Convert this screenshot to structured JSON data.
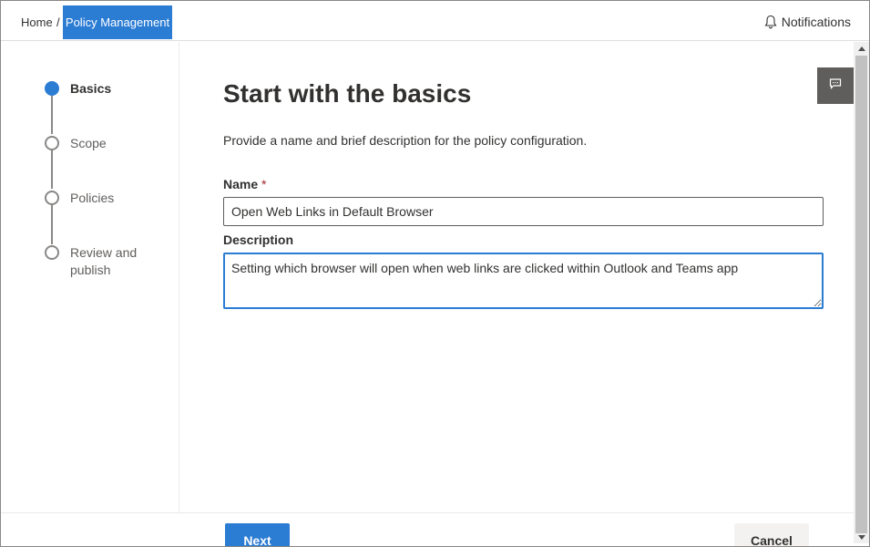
{
  "breadcrumb": {
    "home": "Home",
    "separator": "/",
    "current": "Policy Management"
  },
  "header": {
    "notifications_label": "Notifications",
    "notifications_icon": "bell-icon"
  },
  "steps": [
    {
      "label": "Basics",
      "state": "active"
    },
    {
      "label": "Scope",
      "state": "pending"
    },
    {
      "label": "Policies",
      "state": "pending"
    },
    {
      "label": "Review and publish",
      "state": "pending"
    }
  ],
  "main": {
    "title": "Start with the basics",
    "description": "Provide a name and brief description for the policy configuration.",
    "name_label": "Name",
    "required_marker": "*",
    "name_value": "Open Web Links in Default Browser",
    "description_label": "Description",
    "description_value": "Setting which browser will open when web links are clicked within Outlook and Teams app"
  },
  "feedback": {
    "icon": "feedback-chat-icon"
  },
  "footer": {
    "next_label": "Next",
    "cancel_label": "Cancel"
  },
  "colors": {
    "accent": "#2b7cd3",
    "text": "#323130",
    "muted": "#605e5c",
    "required": "#a4262c"
  }
}
